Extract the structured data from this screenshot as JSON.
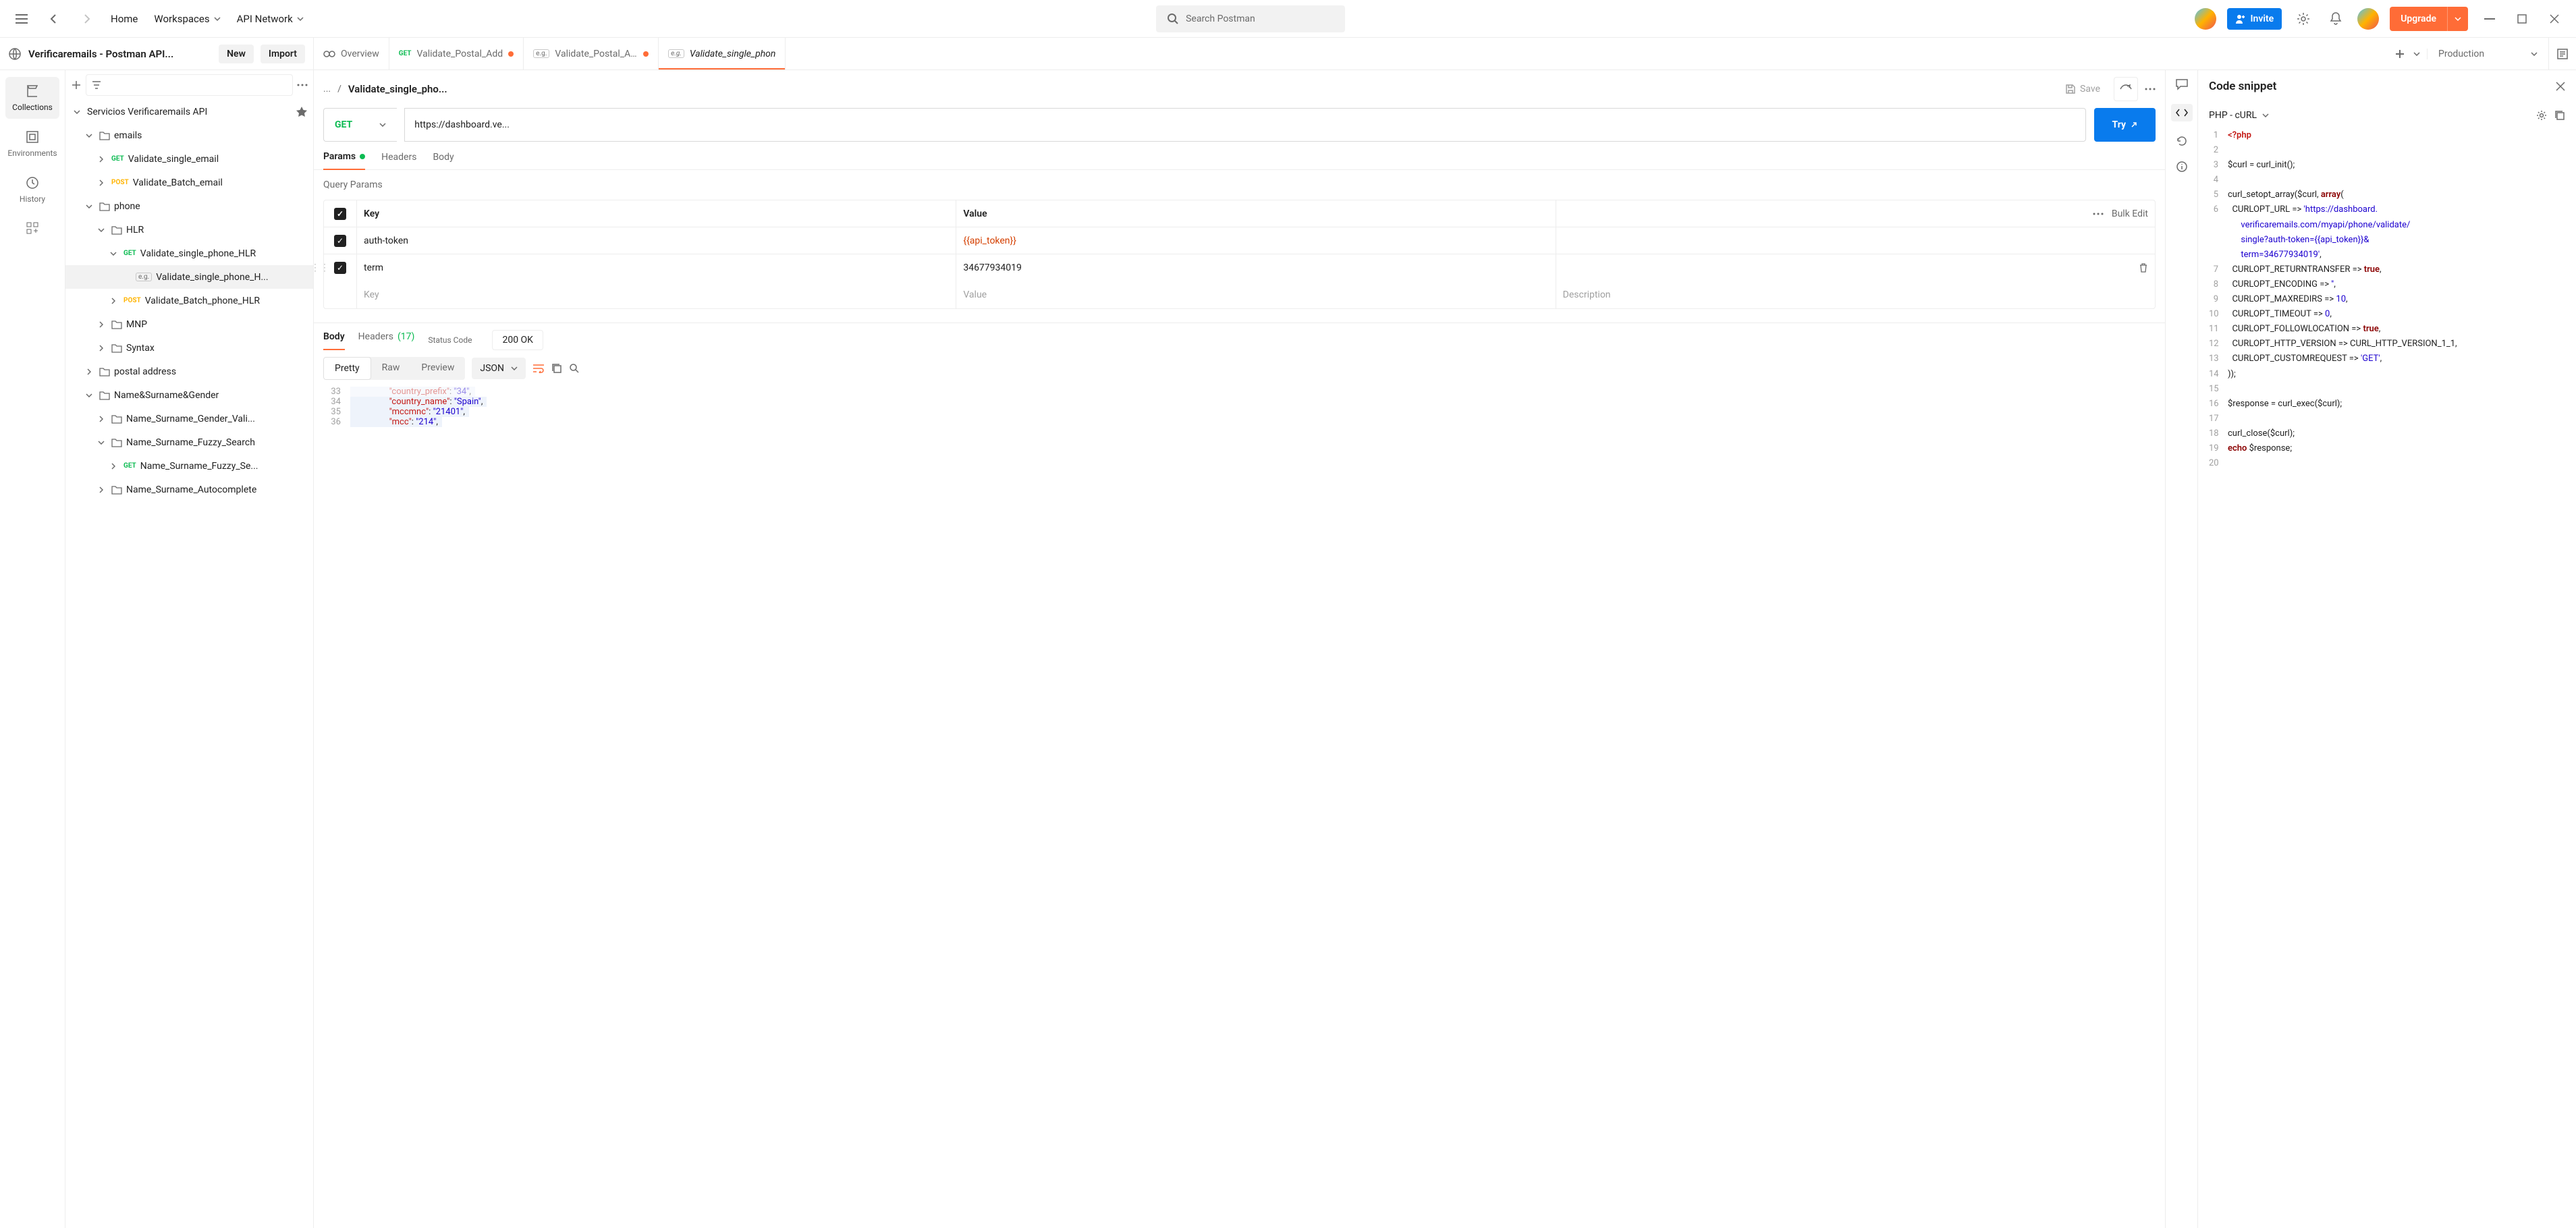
{
  "topnav": {
    "home": "Home",
    "workspaces": "Workspaces",
    "api_network": "API Network",
    "search_placeholder": "Search Postman",
    "invite": "Invite",
    "upgrade": "Upgrade"
  },
  "workspace": {
    "title": "Verificaremails - Postman API...",
    "new_btn": "New",
    "import_btn": "Import"
  },
  "tabs": [
    {
      "icon": "overview",
      "label": "Overview",
      "active": false
    },
    {
      "method": "GET",
      "label": "Validate_Postal_Add",
      "dirty": true
    },
    {
      "eg": true,
      "label": "Validate_Postal_Add",
      "dirty": true
    },
    {
      "eg": true,
      "label": "Validate_single_phon",
      "active": true
    }
  ],
  "environment": "Production",
  "rail": [
    {
      "id": "collections",
      "label": "Collections",
      "active": true
    },
    {
      "id": "environments",
      "label": "Environments"
    },
    {
      "id": "history",
      "label": "History"
    }
  ],
  "tree": {
    "root": "Servicios Verificaremails API",
    "items": [
      {
        "depth": 1,
        "type": "folder",
        "label": "emails",
        "open": true
      },
      {
        "depth": 2,
        "type": "request",
        "method": "GET",
        "label": "Validate_single_email"
      },
      {
        "depth": 2,
        "type": "request",
        "method": "POST",
        "label": "Validate_Batch_email"
      },
      {
        "depth": 1,
        "type": "folder",
        "label": "phone",
        "open": true
      },
      {
        "depth": 2,
        "type": "folder",
        "label": "HLR",
        "open": true
      },
      {
        "depth": 3,
        "type": "request",
        "method": "GET",
        "label": "Validate_single_phone_HLR",
        "open": true
      },
      {
        "depth": 4,
        "type": "example",
        "label": "Validate_single_phone_H...",
        "selected": true
      },
      {
        "depth": 3,
        "type": "request",
        "method": "POST",
        "label": "Validate_Batch_phone_HLR"
      },
      {
        "depth": 2,
        "type": "folder",
        "label": "MNP"
      },
      {
        "depth": 2,
        "type": "folder",
        "label": "Syntax"
      },
      {
        "depth": 1,
        "type": "folder",
        "label": "postal address"
      },
      {
        "depth": 1,
        "type": "folder",
        "label": "Name&Surname&Gender",
        "open": true
      },
      {
        "depth": 2,
        "type": "folder",
        "label": "Name_Surname_Gender_Vali..."
      },
      {
        "depth": 2,
        "type": "folder",
        "label": "Name_Surname_Fuzzy_Search",
        "open": true
      },
      {
        "depth": 3,
        "type": "request",
        "method": "GET",
        "label": "Name_Surname_Fuzzy_Se..."
      },
      {
        "depth": 2,
        "type": "folder",
        "label": "Name_Surname_Autocomplete"
      }
    ]
  },
  "request": {
    "crumb": "...",
    "title": "Validate_single_pho...",
    "save": "Save",
    "method": "GET",
    "url": "https://dashboard.ve...",
    "try": "Try",
    "tabs": {
      "params": "Params",
      "headers": "Headers",
      "body": "Body"
    },
    "section": "Query Params",
    "table": {
      "head": {
        "key": "Key",
        "value": "Value",
        "bulk": "Bulk Edit"
      },
      "rows": [
        {
          "key": "auth-token",
          "value": "{{api_token}}",
          "isvar": true
        },
        {
          "key": "term",
          "value": "34677934019"
        }
      ],
      "placeholders": {
        "key": "Key",
        "value": "Value",
        "desc": "Description"
      }
    }
  },
  "response": {
    "tabs": {
      "body": "Body",
      "headers": "Headers",
      "headers_count": "(17)",
      "status_label": "Status Code"
    },
    "status": "200 OK",
    "views": {
      "pretty": "Pretty",
      "raw": "Raw",
      "preview": "Preview"
    },
    "format": "JSON",
    "json": [
      {
        "n": 33,
        "indent": 4,
        "key": "country_prefix",
        "value": "34",
        "trail": ",",
        "faded": true
      },
      {
        "n": 34,
        "indent": 4,
        "key": "country_name",
        "value": "Spain",
        "trail": ","
      },
      {
        "n": 35,
        "indent": 4,
        "key": "mccmnc",
        "value": "21401",
        "trail": ","
      },
      {
        "n": 36,
        "indent": 4,
        "key": "mcc",
        "value": "214",
        "trail": ","
      }
    ]
  },
  "snippet": {
    "title": "Code snippet",
    "lang": "PHP - cURL",
    "code": [
      {
        "n": 1,
        "html": "<span class='php-tag'>&lt;?php</span>"
      },
      {
        "n": 2,
        "html": ""
      },
      {
        "n": 3,
        "html": "<span class='php-var'>$curl</span> = curl_init();"
      },
      {
        "n": 4,
        "html": ""
      },
      {
        "n": 5,
        "html": "curl_setopt_array(<span class='php-var'>$curl</span>, <span class='php-kw'>array</span>("
      },
      {
        "n": 6,
        "html": "  CURLOPT_URL =&gt; <span class='php-str'>'https://dashboard.</span>"
      },
      {
        "n": "",
        "html": "      <span class='php-str'>verificaremails.com/myapi/phone/validate/</span>"
      },
      {
        "n": "",
        "html": "      <span class='php-str'>single?auth-token={{api_token}}&amp;</span>"
      },
      {
        "n": "",
        "html": "      <span class='php-str'>term=34677934019'</span>,"
      },
      {
        "n": 7,
        "html": "  CURLOPT_RETURNTRANSFER =&gt; <span class='php-bool'>true</span>,"
      },
      {
        "n": 8,
        "html": "  CURLOPT_ENCODING =&gt; <span class='php-str'>''</span>,"
      },
      {
        "n": 9,
        "html": "  CURLOPT_MAXREDIRS =&gt; <span class='php-str'>10</span>,"
      },
      {
        "n": 10,
        "html": "  CURLOPT_TIMEOUT =&gt; <span class='php-str'>0</span>,"
      },
      {
        "n": 11,
        "html": "  CURLOPT_FOLLOWLOCATION =&gt; <span class='php-bool'>true</span>,"
      },
      {
        "n": 12,
        "html": "  CURLOPT_HTTP_VERSION =&gt; CURL_HTTP_VERSION_1_1,"
      },
      {
        "n": 13,
        "html": "  CURLOPT_CUSTOMREQUEST =&gt; <span class='php-str'>'GET'</span>,"
      },
      {
        "n": 14,
        "html": "));"
      },
      {
        "n": 15,
        "html": ""
      },
      {
        "n": 16,
        "html": "<span class='php-var'>$response</span> = curl_exec(<span class='php-var'>$curl</span>);"
      },
      {
        "n": 17,
        "html": ""
      },
      {
        "n": 18,
        "html": "curl_close(<span class='php-var'>$curl</span>);"
      },
      {
        "n": 19,
        "html": "<span class='php-kw'>echo</span> <span class='php-var'>$response</span>;"
      },
      {
        "n": 20,
        "html": ""
      }
    ]
  }
}
